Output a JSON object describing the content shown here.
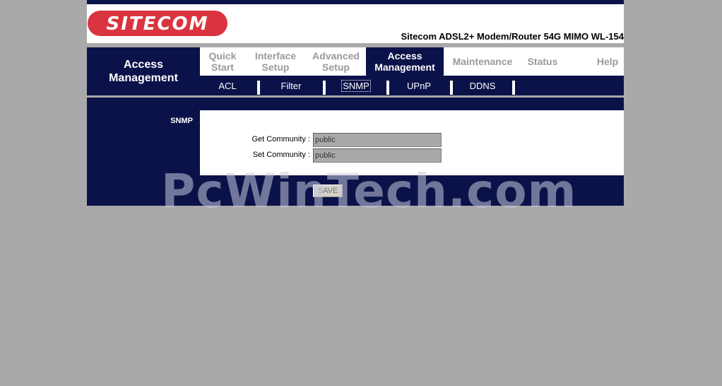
{
  "brand": {
    "logo_text": "SITECOM",
    "product_title": "Sitecom ADSL2+ Modem/Router 54G MIMO WL-154",
    "colors": {
      "navy": "#0b1249",
      "logo_red": "#d9343f",
      "gray": "#a9a9a9"
    }
  },
  "nav": {
    "section_label_line1": "Access",
    "section_label_line2": "Management",
    "tabs": [
      {
        "line1": "Quick",
        "line2": "Start"
      },
      {
        "line1": "Interface",
        "line2": "Setup"
      },
      {
        "line1": "Advanced",
        "line2": "Setup"
      },
      {
        "line1": "Access",
        "line2": "Management",
        "active": true
      },
      {
        "line1": "Maintenance",
        "line2": ""
      },
      {
        "line1": "Status",
        "line2": ""
      },
      {
        "line1": "Help",
        "line2": ""
      }
    ]
  },
  "subnav": {
    "items": [
      {
        "label": "ACL"
      },
      {
        "label": "Filter"
      },
      {
        "label": "SNMP",
        "active": true
      },
      {
        "label": "UPnP"
      },
      {
        "label": "DDNS"
      }
    ]
  },
  "content": {
    "section_title": "SNMP",
    "get_community_label": "Get Community :",
    "get_community_value": "public",
    "set_community_label": "Set Community :",
    "set_community_value": "public",
    "save_label": "SAVE"
  },
  "watermark": "PcWinTech.com"
}
